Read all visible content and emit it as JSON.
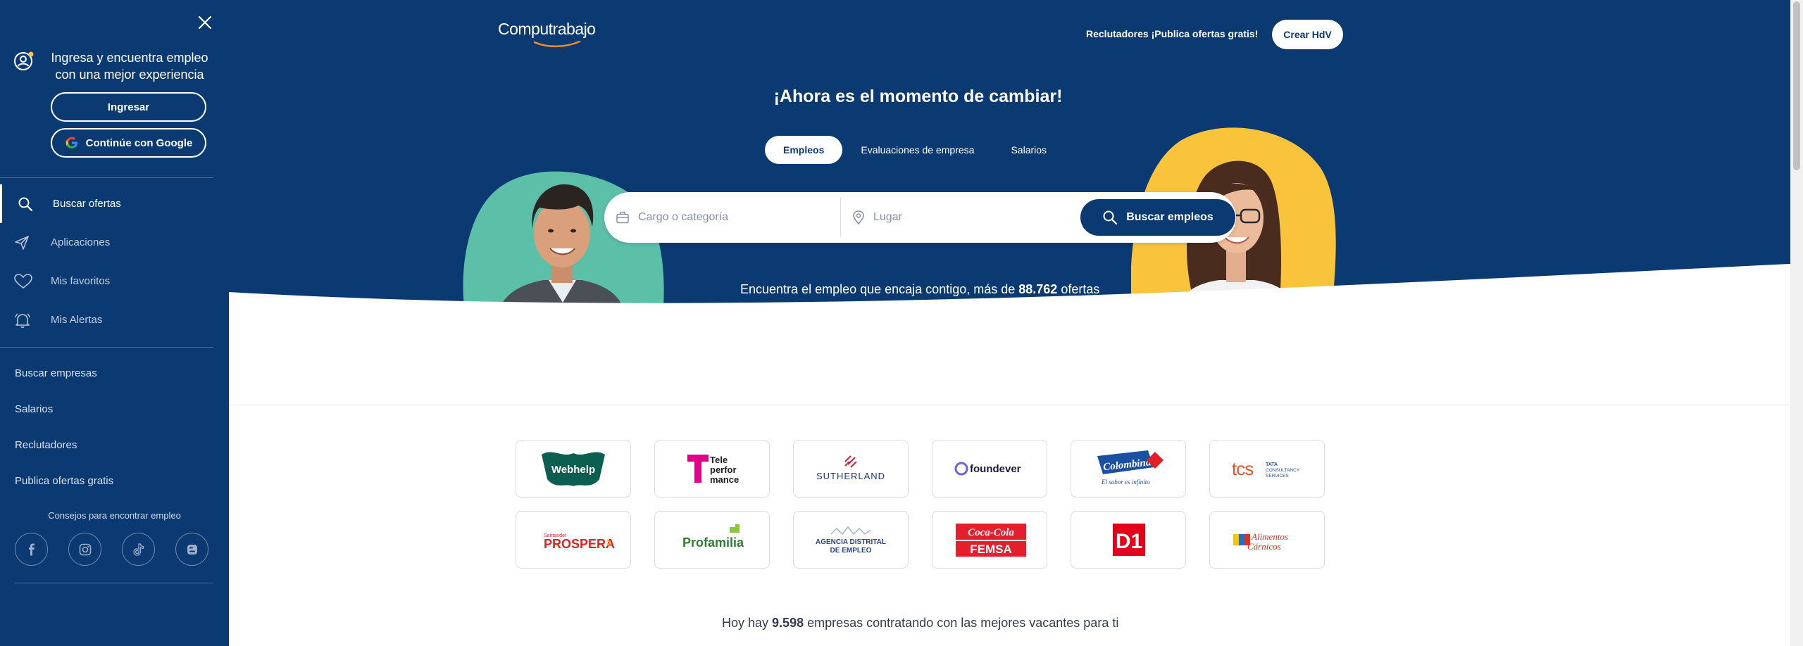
{
  "sidebar": {
    "login_text": "Ingresa y encuentra empleo con una mejor experiencia",
    "login_button": "Ingresar",
    "google_button": "Continúe con Google",
    "nav": [
      {
        "label": "Buscar ofertas",
        "icon": "search-icon"
      },
      {
        "label": "Aplicaciones",
        "icon": "send-icon"
      },
      {
        "label": "Mis favoritos",
        "icon": "heart-icon"
      },
      {
        "label": "Mis Alertas",
        "icon": "bell-icon"
      }
    ],
    "links": [
      "Buscar empresas",
      "Salarios",
      "Reclutadores",
      "Publica ofertas gratis"
    ],
    "tips_title": "Consejos para encontrar empleo",
    "socials": [
      "facebook-icon",
      "instagram-icon",
      "tiktok-icon",
      "blog-icon"
    ]
  },
  "header": {
    "logo": "Computrabajo",
    "recruiters_link": "Reclutadores ¡Publica ofertas gratis!",
    "create_cv_button": "Crear HdV"
  },
  "hero": {
    "headline": "¡Ahora es el momento de cambiar!",
    "tabs": [
      "Empleos",
      "Evaluaciones de empresa",
      "Salarios"
    ],
    "active_tab": "Empleos",
    "search": {
      "job_placeholder": "Cargo o categoría",
      "place_placeholder": "Lugar",
      "button": "Buscar empleos"
    },
    "offers_prefix": "Encuentra el empleo que encaja contigo, más de ",
    "offers_count": "88.762",
    "offers_suffix": " ofertas"
  },
  "companies": {
    "logos": [
      "Webhelp",
      "Teleperformance",
      "SUTHERLAND",
      "foundever",
      "Colombina",
      "tcs",
      "Prospera",
      "Profamilia",
      "Agencia Distrital de Empleo",
      "Coca-Cola FEMSA",
      "D1",
      "Alimentos Cárnicos"
    ],
    "count_prefix": "Hoy hay ",
    "count": "9.598",
    "count_suffix": " empresas contratando con las mejores vacantes para ti"
  },
  "colors": {
    "primary": "#0b3a73",
    "teal_blob": "#5cbfa8",
    "yellow_blob": "#f9c33c"
  }
}
